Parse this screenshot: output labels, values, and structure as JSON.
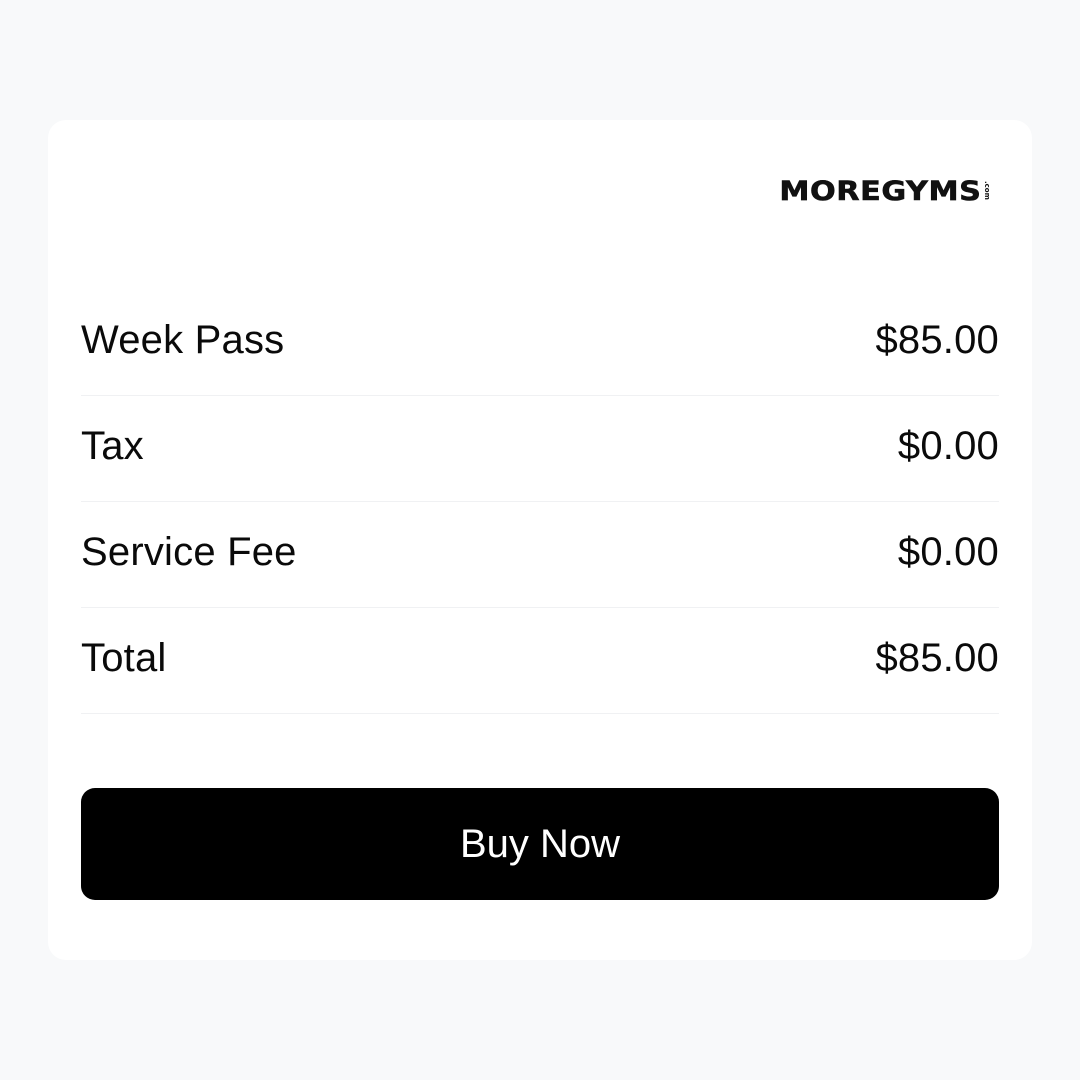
{
  "brand": {
    "logo_text": "MOREGYMS",
    "logo_suffix": ".com"
  },
  "summary": {
    "items": [
      {
        "label": "Week Pass",
        "value": "$85.00"
      },
      {
        "label": "Tax",
        "value": "$0.00"
      },
      {
        "label": "Service Fee",
        "value": "$0.00"
      },
      {
        "label": "Total",
        "value": "$85.00"
      }
    ]
  },
  "actions": {
    "buy_label": "Buy Now"
  },
  "colors": {
    "page_background": "#f8f9fa",
    "card_background": "#ffffff",
    "button_background": "#000000",
    "button_text": "#ffffff"
  }
}
